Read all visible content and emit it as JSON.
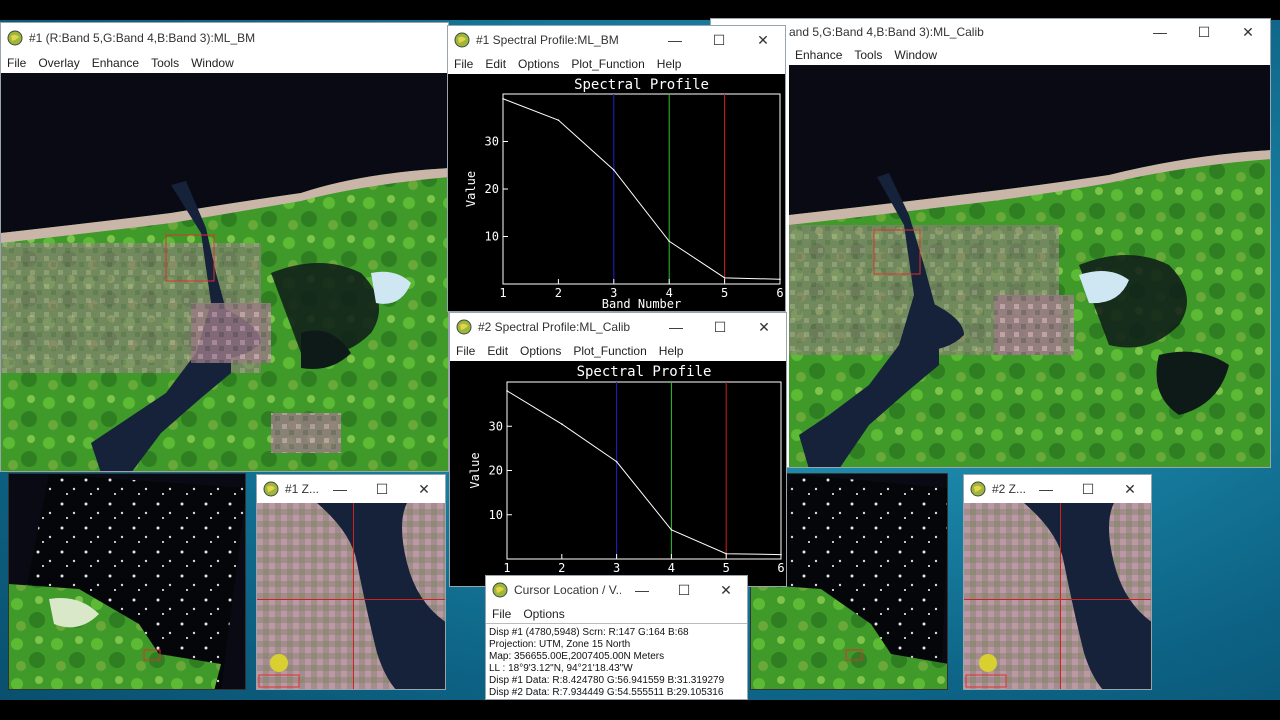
{
  "colors": {
    "accent_blue": "#1f1fd0",
    "accent_green": "#2ec02e",
    "accent_red": "#d02020",
    "roi_red": "#e03030"
  },
  "window_bm": {
    "title": "#1 (R:Band 5,G:Band 4,B:Band 3):ML_BM",
    "menu": [
      "File",
      "Overlay",
      "Enhance",
      "Tools",
      "Window"
    ]
  },
  "window_calib": {
    "title": "and 5,G:Band 4,B:Band 3):ML_Calib",
    "menu": [
      "Enhance",
      "Tools",
      "Window"
    ]
  },
  "spectral1": {
    "title": "#1 Spectral Profile:ML_BM",
    "menu": [
      "File",
      "Edit",
      "Options",
      "Plot_Function",
      "Help"
    ],
    "plot_title": "Spectral Profile",
    "xlabel": "Band Number",
    "ylabel": "Value"
  },
  "spectral2": {
    "title": "#2 Spectral Profile:ML_Calib",
    "menu": [
      "File",
      "Edit",
      "Options",
      "Plot_Function",
      "Help"
    ],
    "plot_title": "Spectral Profile",
    "ylabel": "Value"
  },
  "zoom1": {
    "title": "#1 Z..."
  },
  "zoom2": {
    "title": "#2 Z..."
  },
  "cursor": {
    "title": "Cursor Location / V...",
    "menu": [
      "File",
      "Options"
    ],
    "lines": [
      "Disp #1 (4780,5948) Scrn: R:147 G:164 B:68",
      "Projection: UTM, Zone 15 North",
      "Map: 356655.00E,2007405.00N Meters",
      "LL : 18°9'3.12\"N, 94°21'18.43\"W",
      "Disp #1 Data: R:8.424780 G:56.941559 B:31.319279",
      "Disp #2 Data: R:7.934449 G:54.555511 B:29.105316"
    ]
  },
  "chart_data": [
    {
      "type": "line",
      "title": "Spectral Profile",
      "xlabel": "Band Number",
      "ylabel": "Value",
      "x": [
        1,
        2,
        3,
        4,
        5,
        6
      ],
      "series": [
        {
          "values": [
            39,
            34.5,
            24,
            9,
            1.3,
            1
          ]
        }
      ],
      "xlim": [
        1,
        6
      ],
      "ylim": [
        0,
        40
      ],
      "xticks": [
        1,
        2,
        3,
        4,
        5,
        6
      ],
      "yticks": [
        10,
        20,
        30
      ],
      "band_markers": [
        {
          "x": 3,
          "color": "#1f1fd0"
        },
        {
          "x": 4,
          "color": "#2ec02e"
        },
        {
          "x": 5,
          "color": "#d02020"
        }
      ]
    },
    {
      "type": "line",
      "title": "Spectral Profile",
      "xlabel": "",
      "ylabel": "Value",
      "x": [
        1,
        2,
        3,
        4,
        5,
        6
      ],
      "series": [
        {
          "values": [
            38,
            30.5,
            22,
            6.6,
            1.2,
            1
          ]
        }
      ],
      "xlim": [
        1,
        6
      ],
      "ylim": [
        0,
        40
      ],
      "xticks": [
        1,
        2,
        3,
        4,
        5,
        6
      ],
      "yticks": [
        10,
        20,
        30
      ],
      "band_markers": [
        {
          "x": 3,
          "color": "#1f1fd0"
        },
        {
          "x": 4,
          "color": "#2ec02e"
        },
        {
          "x": 5,
          "color": "#d02020"
        }
      ]
    }
  ]
}
